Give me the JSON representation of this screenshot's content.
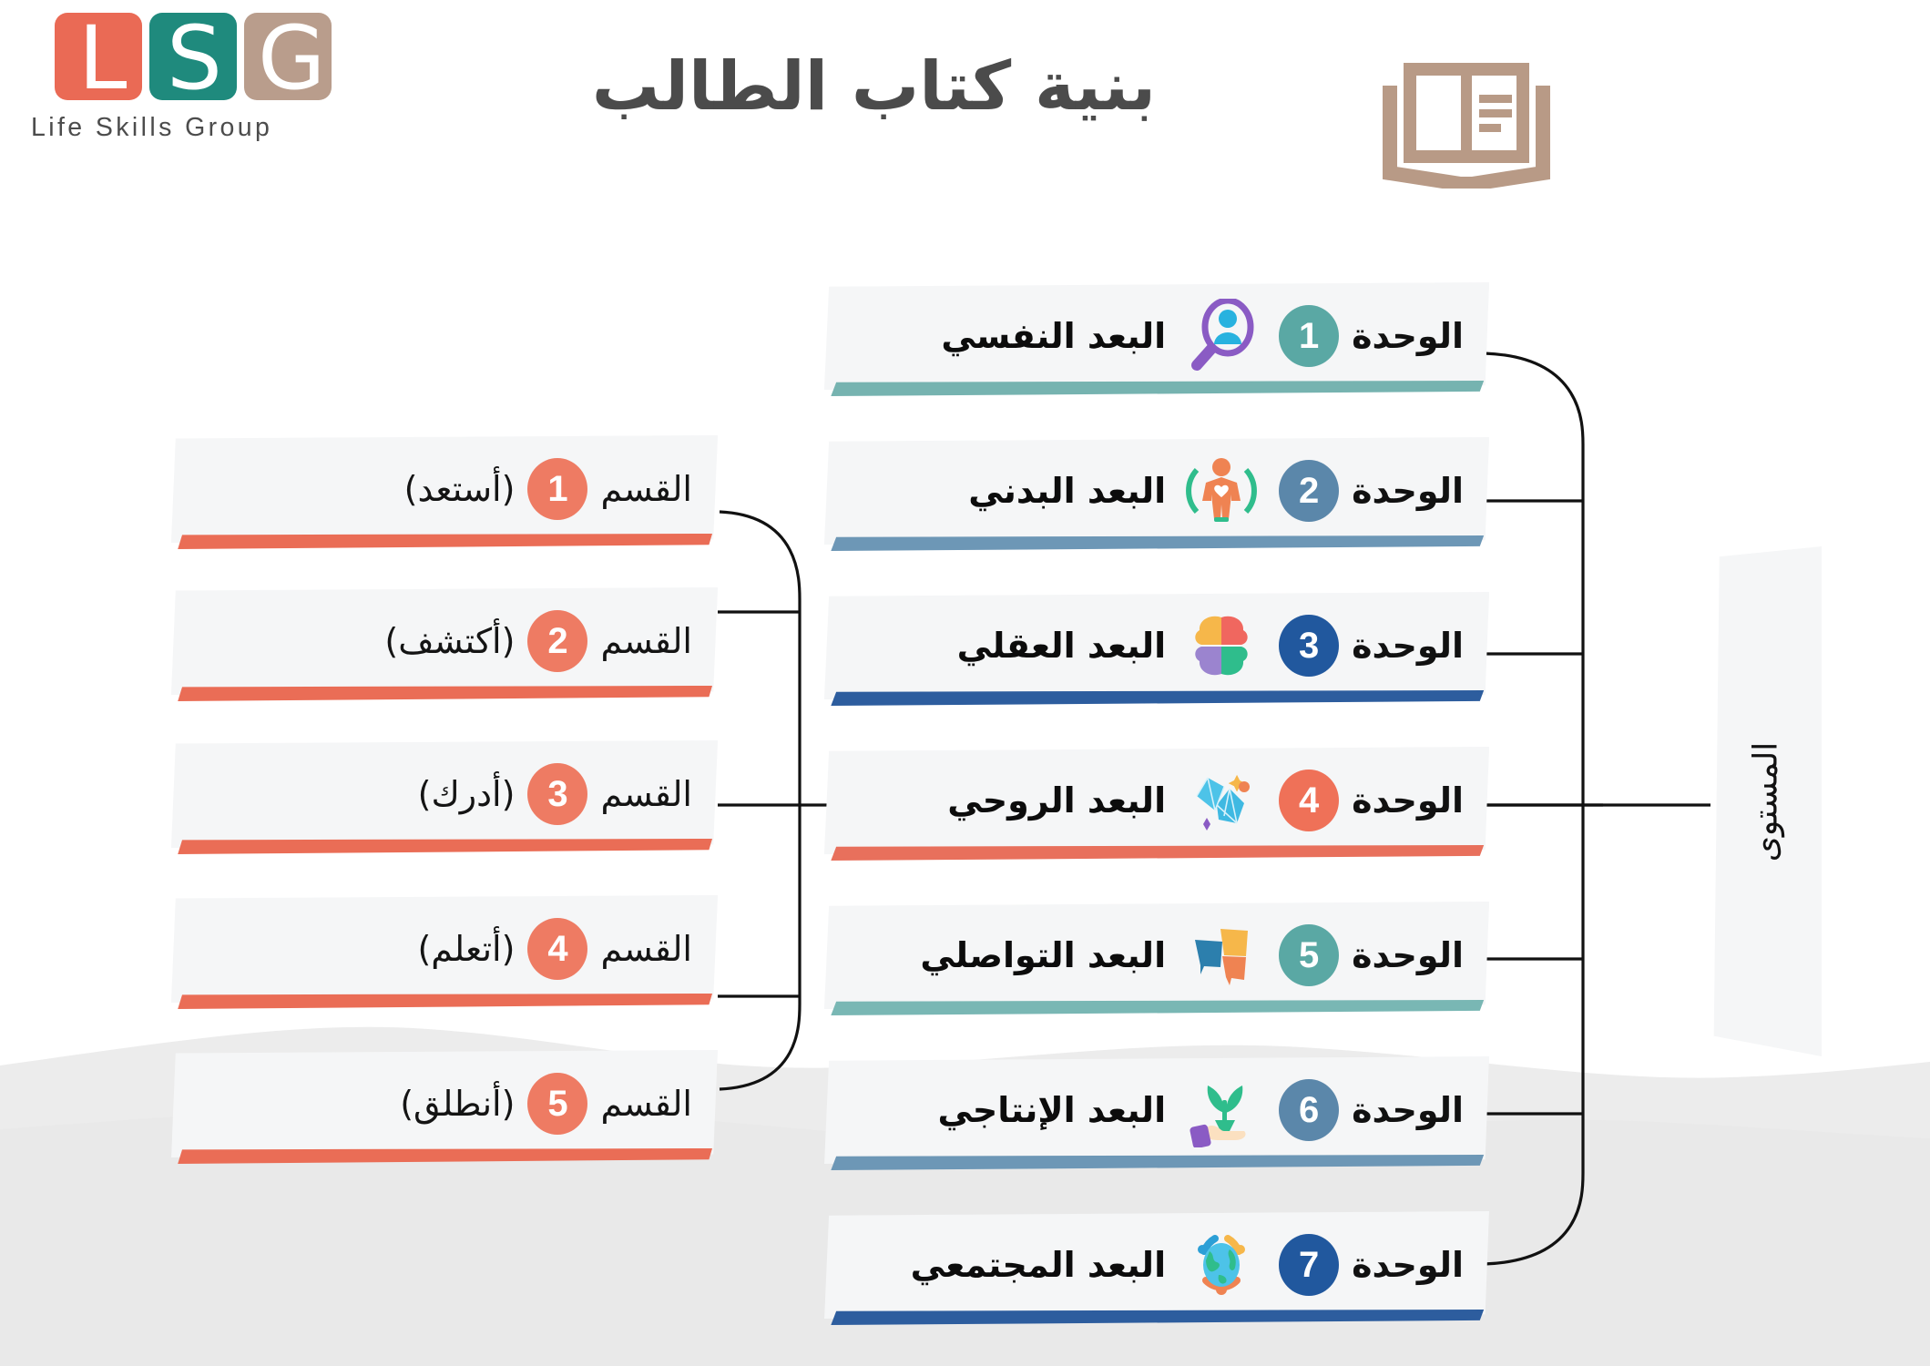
{
  "brand": {
    "logo_letters": [
      "L",
      "S",
      "G"
    ],
    "logo_word": "Life Skills Group",
    "colors": {
      "coral": "#ea6a55",
      "teal": "#1f8a7d",
      "tan": "#b99d8c"
    }
  },
  "header": {
    "title": "بنية كتاب الطالب",
    "book_icon": "open-book-icon",
    "book_icon_color": "#b89a86"
  },
  "sections_column": {
    "prefix": "القسم",
    "items": [
      {
        "number": "1",
        "name": "(أستعد)",
        "badge_color": "#ee7b63",
        "bar_color": "#ea6d56"
      },
      {
        "number": "2",
        "name": "(أكتشف)",
        "badge_color": "#ee7b63",
        "bar_color": "#ea6d56"
      },
      {
        "number": "3",
        "name": "(أدرك)",
        "badge_color": "#ee7b63",
        "bar_color": "#ea6d56"
      },
      {
        "number": "4",
        "name": "(أتعلم)",
        "badge_color": "#ee7b63",
        "bar_color": "#ea6d56"
      },
      {
        "number": "5",
        "name": "(أنطلق)",
        "badge_color": "#ee7b63",
        "bar_color": "#ea6d56"
      }
    ]
  },
  "units_column": {
    "prefix": "الوحدة",
    "items": [
      {
        "number": "1",
        "name": "البعد النفسي",
        "icon": "magnifier-person-icon",
        "badge_color": "#5aa8a4",
        "bar_color": "#76b3b0"
      },
      {
        "number": "2",
        "name": "البعد البدني",
        "icon": "body-person-heart-icon",
        "badge_color": "#5b87aa",
        "bar_color": "#6d97b6"
      },
      {
        "number": "3",
        "name": "البعد العقلي",
        "icon": "brain-quadrants-icon",
        "badge_color": "#21589e",
        "bar_color": "#2d5d9e"
      },
      {
        "number": "4",
        "name": "البعد الروحي",
        "icon": "gems-sparkle-icon",
        "badge_color": "#ef7158",
        "bar_color": "#e8705c"
      },
      {
        "number": "5",
        "name": "البعد التواصلي",
        "icon": "speech-bubbles-icon",
        "badge_color": "#5aa8a4",
        "bar_color": "#79b7b4"
      },
      {
        "number": "6",
        "name": "البعد الإنتاجي",
        "icon": "hand-sprout-icon",
        "badge_color": "#5b87aa",
        "bar_color": "#6d97b6"
      },
      {
        "number": "7",
        "name": "البعد المجتمعي",
        "icon": "globe-people-icon",
        "badge_color": "#21589e",
        "bar_color": "#2d5d9e"
      }
    ]
  },
  "level_panel": {
    "label": "المستوى"
  }
}
